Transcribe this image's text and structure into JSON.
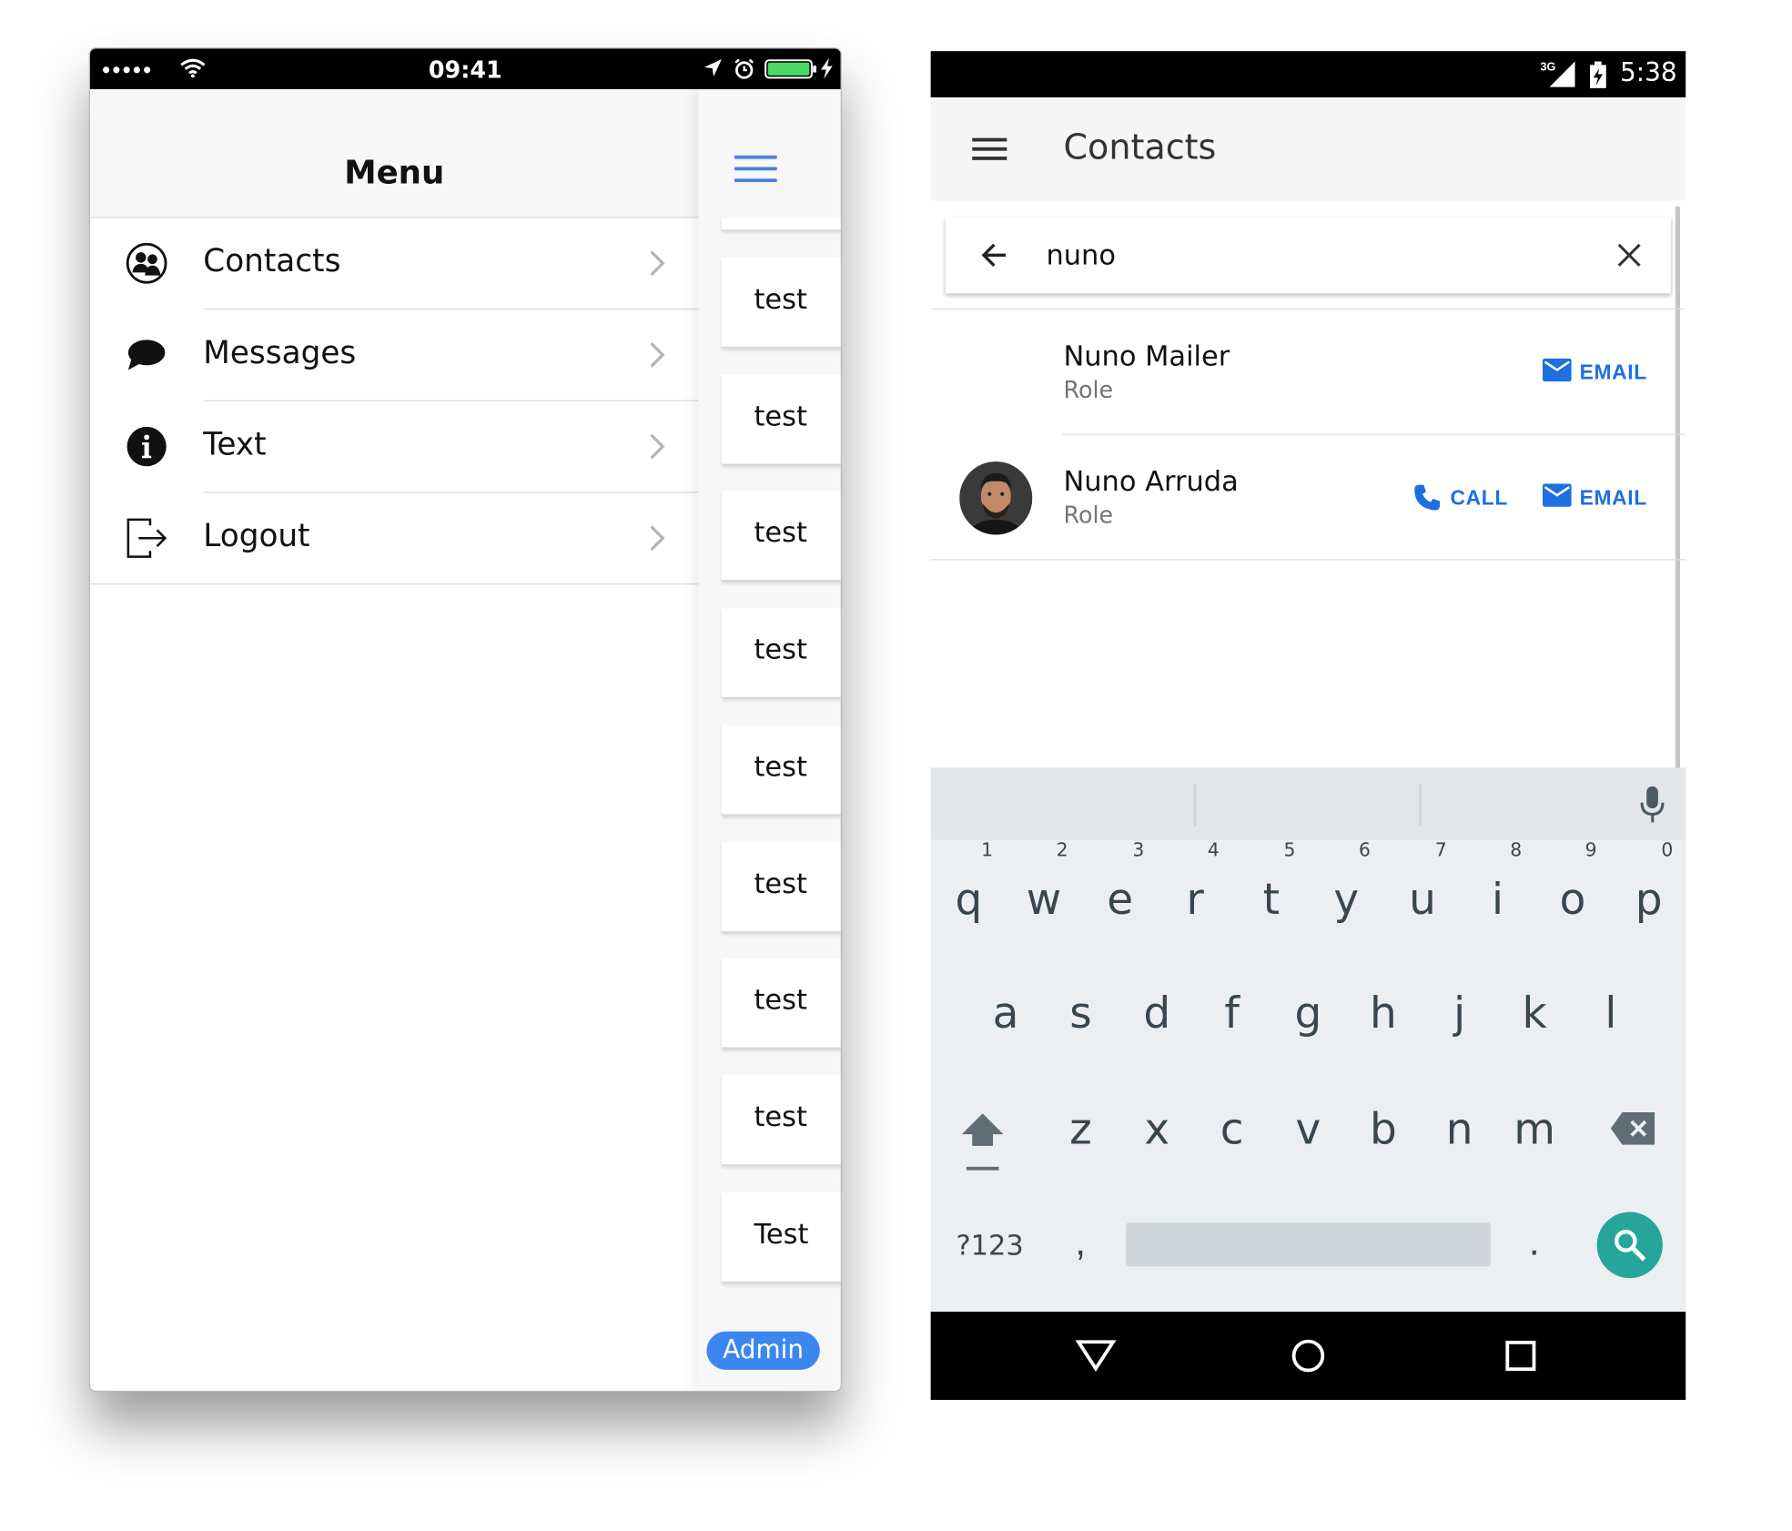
{
  "ios": {
    "status": {
      "signal": "●●●●●",
      "time": "09:41"
    },
    "menu_title": "Menu",
    "menu_items": [
      {
        "label": "Contacts",
        "icon": "contacts-icon"
      },
      {
        "label": "Messages",
        "icon": "chat-bubble-icon"
      },
      {
        "label": "Text",
        "icon": "info-icon"
      },
      {
        "label": "Logout",
        "icon": "logout-icon"
      }
    ],
    "side_cards": [
      "test",
      "test",
      "test",
      "test",
      "test",
      "test",
      "test",
      "test",
      "Test"
    ],
    "badge": "Admin",
    "accent": "#3c86f0"
  },
  "android": {
    "status": {
      "network": "3G",
      "time": "5:38"
    },
    "title": "Contacts",
    "search_query": "nuno",
    "contacts": [
      {
        "name": "Nuno Mailer",
        "role": "Role",
        "actions": [
          "EMAIL"
        ]
      },
      {
        "name": "Nuno Arruda",
        "role": "Role",
        "actions": [
          "CALL",
          "EMAIL"
        ]
      }
    ],
    "keyboard": {
      "row1": [
        {
          "k": "q",
          "n": "1"
        },
        {
          "k": "w",
          "n": "2"
        },
        {
          "k": "e",
          "n": "3"
        },
        {
          "k": "r",
          "n": "4"
        },
        {
          "k": "t",
          "n": "5"
        },
        {
          "k": "y",
          "n": "6"
        },
        {
          "k": "u",
          "n": "7"
        },
        {
          "k": "i",
          "n": "8"
        },
        {
          "k": "o",
          "n": "9"
        },
        {
          "k": "p",
          "n": "0"
        }
      ],
      "row2": [
        "a",
        "s",
        "d",
        "f",
        "g",
        "h",
        "j",
        "k",
        "l"
      ],
      "row3": [
        "z",
        "x",
        "c",
        "v",
        "b",
        "n",
        "m"
      ],
      "symbols": "?123",
      "comma": ",",
      "period": "."
    },
    "accent": "#1e6fe0",
    "search_key_color": "#26a69a"
  }
}
